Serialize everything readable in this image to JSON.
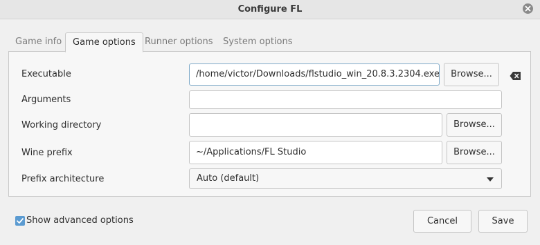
{
  "window": {
    "title": "Configure FL"
  },
  "tabs": [
    {
      "label": "Game info",
      "active": false
    },
    {
      "label": "Game options",
      "active": true
    },
    {
      "label": "Runner options",
      "active": false
    },
    {
      "label": "System options",
      "active": false
    }
  ],
  "form": {
    "executable": {
      "label": "Executable",
      "value": "/home/victor/Downloads/flstudio_win_20.8.3.2304.exe",
      "browse_label": "Browse..."
    },
    "arguments": {
      "label": "Arguments",
      "value": ""
    },
    "working_directory": {
      "label": "Working directory",
      "value": "",
      "browse_label": "Browse..."
    },
    "wine_prefix": {
      "label": "Wine prefix",
      "value": "~/Applications/FL Studio",
      "browse_label": "Browse..."
    },
    "prefix_architecture": {
      "label": "Prefix architecture",
      "selected": "Auto (default)"
    }
  },
  "footer": {
    "show_advanced_label": "Show advanced options",
    "show_advanced_checked": true,
    "cancel_label": "Cancel",
    "save_label": "Save"
  },
  "colors": {
    "accent": "#5b9bd1",
    "focus_border": "#7da9c8"
  },
  "icons": {
    "close": "close-icon",
    "clear": "backspace-clear-icon",
    "dropdown": "chevron-down-icon",
    "check": "check-icon"
  }
}
